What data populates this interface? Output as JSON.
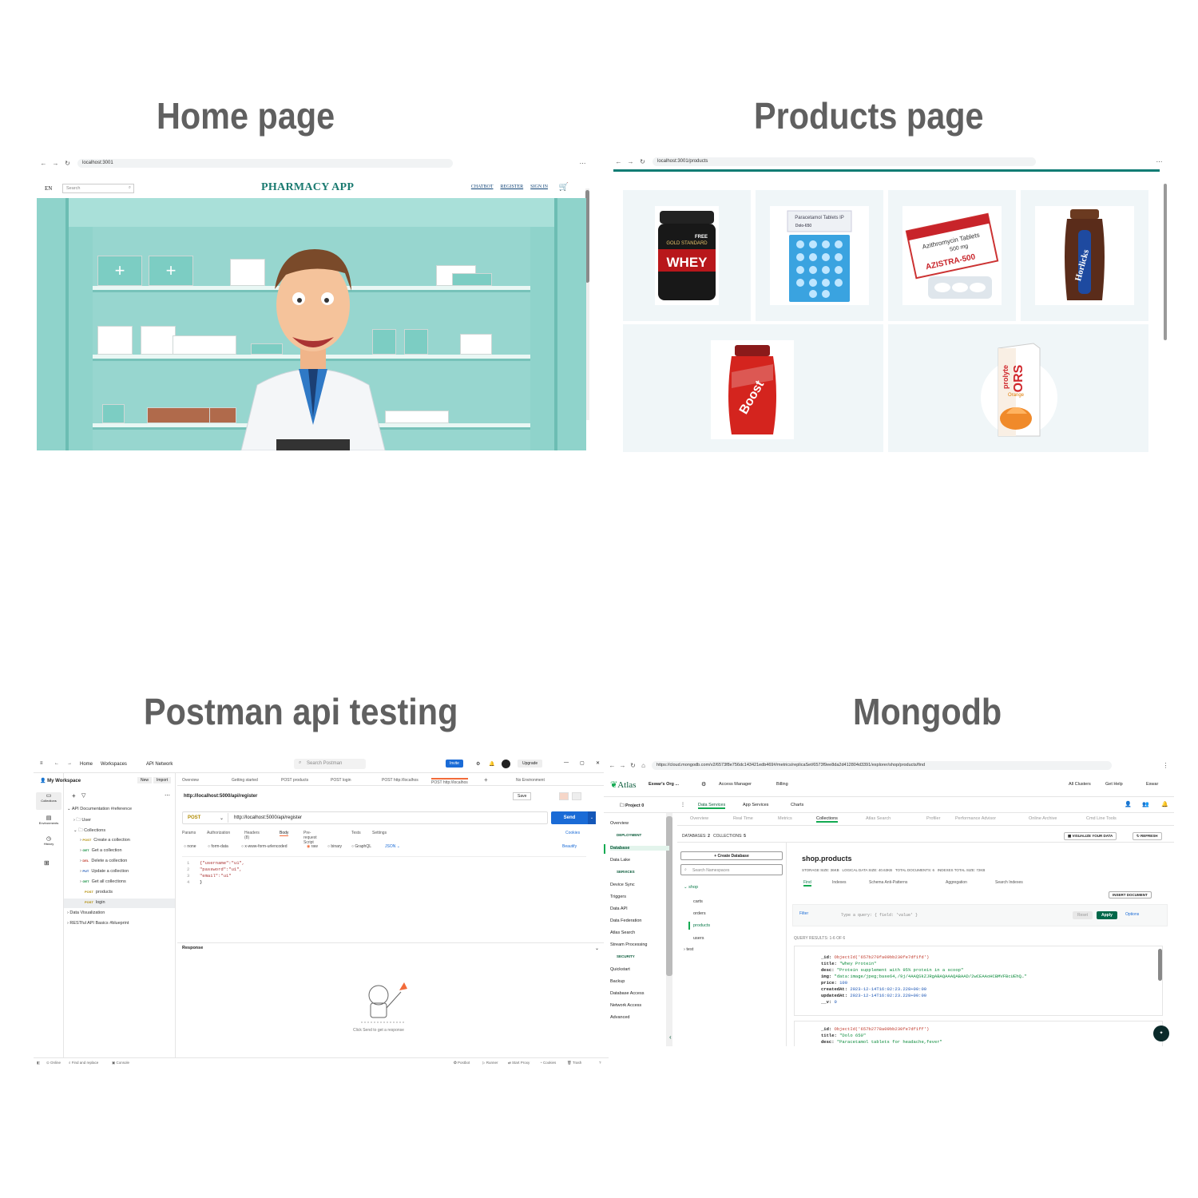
{
  "titles": {
    "home": "Home page",
    "products": "Products page",
    "postman": "Postman api testing",
    "mongodb": "Mongodb"
  },
  "home": {
    "url": "localhost:3001",
    "lang": "EN",
    "search_placeholder": "Search",
    "brand": "PHARMACY APP",
    "links": [
      "CHATBOT",
      "REGISTER",
      "SIGN IN"
    ],
    "cart_icon": "cart-icon",
    "accent": "#1a7a70"
  },
  "products": {
    "url": "localhost:3001/products",
    "accent": "#0f7c74",
    "items": [
      {
        "name": "whey",
        "label_top": "FREE",
        "label_main": "WHEY",
        "label_sub": "GOLD STANDARD"
      },
      {
        "name": "dolo",
        "label_top": "Paracetamol Tablets IP",
        "label_main": "Dolo-650"
      },
      {
        "name": "azistra",
        "label_top": "Azithromycin Tablets",
        "label_sub": "500 mg",
        "label_main": "AZISTRA-500"
      },
      {
        "name": "horlicks",
        "label_main": "Horlicks"
      },
      {
        "name": "boost",
        "label_main": "Boost"
      },
      {
        "name": "ors",
        "label_top": "prolyte",
        "label_main": "ORS",
        "label_sub": "Orange"
      }
    ]
  },
  "postman": {
    "nav": {
      "home": "Home",
      "workspaces": "Workspaces",
      "api_network": "API Network",
      "search": "Search Postman",
      "invite": "Invite",
      "upgrade": "Upgrade"
    },
    "workspace": "My Workspace",
    "new": "New",
    "import": "Import",
    "rail": [
      "Collections",
      "Environments",
      "History"
    ],
    "tree": [
      {
        "label": "API Documentation #reference",
        "depth": 0
      },
      {
        "label": "User",
        "depth": 1
      },
      {
        "label": "Collections",
        "depth": 1
      },
      {
        "verb": "POST",
        "label": "Create a collection",
        "depth": 2
      },
      {
        "verb": "GET",
        "label": "Get a collection",
        "depth": 2
      },
      {
        "verb": "DEL",
        "label": "Delete a collection",
        "depth": 2
      },
      {
        "verb": "PUT",
        "label": "Update a collection",
        "depth": 2
      },
      {
        "verb": "GET",
        "label": "Get all collections",
        "depth": 2
      },
      {
        "verb": "POST",
        "label": "products",
        "depth": 2
      },
      {
        "verb": "POST",
        "label": "login",
        "depth": 2
      },
      {
        "label": "Data Visualization",
        "depth": 0
      },
      {
        "label": "RESTful API Basics #blueprint",
        "depth": 0
      }
    ],
    "tabs": [
      "Overview",
      "Getting started",
      "POST products",
      "POST login",
      "POST http://localhos",
      "POST http://localhos"
    ],
    "no_env": "No Environment",
    "request_title": "http://localhost:5000/api/register",
    "save": "Save",
    "method": "POST",
    "url": "http://localhost:5000/api/register",
    "send": "Send",
    "req_tabs": [
      "Params",
      "Authorization",
      "Headers (8)",
      "Body",
      "Pre-request Script",
      "Tests",
      "Settings"
    ],
    "cookies": "Cookies",
    "body_types": [
      "none",
      "form-data",
      "x-www-form-urlencoded",
      "raw",
      "binary",
      "GraphQL"
    ],
    "body_format": "JSON",
    "beautify": "Beautify",
    "code": [
      {
        "n": "1",
        "text": "{\"username\":\"u1\","
      },
      {
        "n": "2",
        "text": "\"password\":\"u1\","
      },
      {
        "n": "3",
        "text": "\"email\":\"u1\""
      },
      {
        "n": "4",
        "text": "}"
      }
    ],
    "response": "Response",
    "response_hint": "Click Send to get a response",
    "footer_left": [
      "Online",
      "Find and replace",
      "Console"
    ],
    "footer_right": [
      "Postbot",
      "Runner",
      "Start Proxy",
      "Cookies",
      "Trash"
    ]
  },
  "mongodb": {
    "url": "https://cloud.mongodb.com/v2/6573f8e756dc143421edb469#/metrics/replicaSet/6573f9ee8da2d412804d3391/explorer/shop/products/find",
    "atlas": "Atlas",
    "org": "Eswar's Org ...",
    "access_manager": "Access Manager",
    "billing": "Billing",
    "all_clusters": "All Clusters",
    "get_help": "Get Help",
    "user": "Eswar",
    "project": "Project 0",
    "top_tabs": [
      "Data Services",
      "App Services",
      "Charts"
    ],
    "sub_tabs": [
      "Overview",
      "Real Time",
      "Metrics",
      "Collections",
      "Atlas Search",
      "Profiler",
      "Performance Advisor",
      "Online Archive",
      "Cmd Line Tools"
    ],
    "side": [
      {
        "label": "Overview",
        "kind": "item"
      },
      {
        "label": "DEPLOYMENT",
        "kind": "head"
      },
      {
        "label": "Database",
        "kind": "active"
      },
      {
        "label": "Data Lake",
        "kind": "item"
      },
      {
        "label": "SERVICES",
        "kind": "head"
      },
      {
        "label": "Device Sync",
        "kind": "item"
      },
      {
        "label": "Triggers",
        "kind": "item"
      },
      {
        "label": "Data API",
        "kind": "item"
      },
      {
        "label": "Data Federation",
        "kind": "item"
      },
      {
        "label": "Atlas Search",
        "kind": "item"
      },
      {
        "label": "Stream Processing",
        "kind": "item"
      },
      {
        "label": "SECURITY",
        "kind": "head"
      },
      {
        "label": "Quickstart",
        "kind": "item"
      },
      {
        "label": "Backup",
        "kind": "item"
      },
      {
        "label": "Database Access",
        "kind": "item"
      },
      {
        "label": "Network Access",
        "kind": "item"
      },
      {
        "label": "Advanced",
        "kind": "item"
      }
    ],
    "databases_label": "DATABASES:",
    "databases_count": "2",
    "collections_label": "COLLECTIONS:",
    "collections_count": "5",
    "visualize": "VISUALIZE YOUR DATA",
    "refresh": "REFRESH",
    "create_db": "+ Create Database",
    "search_ns": "Search Namespaces",
    "tree": [
      {
        "label": "shop",
        "depth": 0,
        "active": false,
        "db": true
      },
      {
        "label": "carts",
        "depth": 1,
        "active": false
      },
      {
        "label": "orders",
        "depth": 1,
        "active": false
      },
      {
        "label": "products",
        "depth": 1,
        "active": true
      },
      {
        "label": "users",
        "depth": 1,
        "active": false
      },
      {
        "label": "test",
        "depth": 0,
        "active": false
      }
    ],
    "collection_title": "shop.products",
    "stats": [
      "STORAGE SIZE: 36KB",
      "LOGICAL DATA SIZE: 40.63KB",
      "TOTAL DOCUMENTS: 6",
      "INDEXES TOTAL SIZE: 72KB"
    ],
    "coll_tabs": [
      "Find",
      "Indexes",
      "Schema Anti-Patterns",
      "Aggregation",
      "Search Indexes"
    ],
    "insert": "INSERT DOCUMENT",
    "filter": "Filter",
    "query_placeholder": "Type a query: { field: 'value' }",
    "reset": "Reset",
    "apply": "Apply",
    "options": "Options",
    "results": "QUERY RESULTS: 1-6 OF 6",
    "doc1": [
      {
        "k": "_id:",
        "v": "ObjectId('657b270fa09bb230fe7df1fd')",
        "c": "r"
      },
      {
        "k": "title:",
        "v": "\"Whey Protein\"",
        "c": "g"
      },
      {
        "k": "desc:",
        "v": "\"Protein supplement with 95% protein in a scoop\"",
        "c": "g"
      },
      {
        "k": "img:",
        "v": "\"data:image/jpeg;base64,/9j/4AAQSkZJRgABAQAAAQABAAD/2wCEAAoHCBMVFBcUEhQ…\"",
        "c": "g"
      },
      {
        "k": "price:",
        "v": "100",
        "c": "b"
      },
      {
        "k": "createdAt:",
        "v": "2023-12-14T16:02:23.228+00:00",
        "c": "b"
      },
      {
        "k": "updatedAt:",
        "v": "2023-12-14T16:02:23.228+00:00",
        "c": "b"
      },
      {
        "k": "__v:",
        "v": "0",
        "c": "b"
      }
    ],
    "doc2": [
      {
        "k": "_id:",
        "v": "ObjectId('657b2778a09bb230fe7df1ff')",
        "c": "r"
      },
      {
        "k": "title:",
        "v": "\"Dolo 650\"",
        "c": "g"
      },
      {
        "k": "desc:",
        "v": "\"Paracetamol tablets for headache,fever\"",
        "c": "g"
      }
    ]
  }
}
